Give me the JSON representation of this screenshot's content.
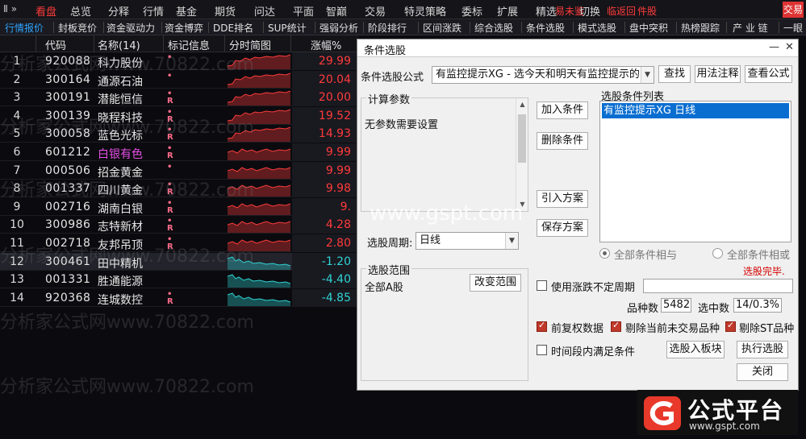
{
  "menu": {
    "logo": "Ⅱ »",
    "items": [
      "看盘",
      "总览",
      "分释",
      "行情",
      "基金",
      "期货",
      "问达",
      "平面",
      "智巅",
      "交易",
      "特灵策略",
      "委标",
      "扩展",
      "精选"
    ],
    "overlay_texts": [
      "易未鉴",
      "切换",
      "临返回",
      "件股"
    ],
    "trade_button": "交易"
  },
  "tabs": [
    "行情报价",
    "封板竞价",
    "资金驱动力",
    "资金博弈",
    "DDE排名",
    "SUP统计",
    "强弱分析",
    "阶段排行",
    "区间涨跌",
    "综合选股",
    "条件选股",
    "模式选股",
    "盘中突积",
    "热榜跟踪",
    "产 业 链",
    "一眼"
  ],
  "table": {
    "headers": [
      "代码",
      "名称(14)",
      "标记信息",
      "分时简图",
      "涨幅%"
    ],
    "rows": [
      {
        "idx": "1",
        "code": "920088",
        "name": "科力股份",
        "mark": "•",
        "pct": "29.99",
        "dir": "up"
      },
      {
        "idx": "2",
        "code": "300164",
        "name": "通源石油",
        "mark": "•",
        "pct": "20.04",
        "dir": "up"
      },
      {
        "idx": "3",
        "code": "300191",
        "name": "潜能恒信",
        "mark": "•R",
        "pct": "20.00",
        "dir": "up"
      },
      {
        "idx": "4",
        "code": "300139",
        "name": "晓程科技",
        "mark": "•R",
        "pct": "19.52",
        "dir": "up"
      },
      {
        "idx": "5",
        "code": "300058",
        "name": "蓝色光标",
        "mark": "•R",
        "pct": "14.93",
        "dir": "up"
      },
      {
        "idx": "6",
        "code": "601212",
        "name": "白银有色",
        "mark": "•R",
        "pct": "9.99",
        "dir": "up",
        "magenta": true
      },
      {
        "idx": "7",
        "code": "000506",
        "name": "招金黄金",
        "mark": "•",
        "pct": "9.99",
        "dir": "up"
      },
      {
        "idx": "8",
        "code": "001337",
        "name": "四川黄金",
        "mark": "•R",
        "pct": "9.98",
        "dir": "up"
      },
      {
        "idx": "9",
        "code": "002716",
        "name": "湖南白银",
        "mark": "•R",
        "pct": "9.",
        "dir": "up"
      },
      {
        "idx": "10",
        "code": "300986",
        "name": "志特新材",
        "mark": "•R",
        "pct": "4.28",
        "dir": "up"
      },
      {
        "idx": "11",
        "code": "002718",
        "name": "友邦吊顶",
        "mark": "•R",
        "pct": "2.80",
        "dir": "up"
      },
      {
        "idx": "12",
        "code": "300461",
        "name": "田中精机",
        "mark": "",
        "pct": "-1.20",
        "dir": "down"
      },
      {
        "idx": "13",
        "code": "001331",
        "name": "胜通能源",
        "mark": "",
        "pct": "-4.40",
        "dir": "down"
      },
      {
        "idx": "14",
        "code": "920368",
        "name": "连城数控",
        "mark": "•R",
        "pct": "-4.85",
        "dir": "down"
      }
    ]
  },
  "watermark": {
    "a": "分析家公式网www.70822.com",
    "b": "分析家公式网www.70822.com"
  },
  "dialog": {
    "title": "条件选股",
    "formula_label": "条件选股公式",
    "formula_value": "有监控提示XG  -  选今天和明天有监控提示的",
    "find_btn": "查找",
    "usage_btn": "用法注释",
    "view_formula_btn": "查看公式",
    "calc_params_legend": "计算参数",
    "no_params_text": "无参数需要设置",
    "add_condition_btn": "加入条件",
    "delete_condition_btn": "删除条件",
    "import_scheme_btn": "引入方案",
    "save_scheme_btn": "保存方案",
    "condition_list_label": "选股条件列表",
    "condition_item": "有监控提示XG  日线",
    "period_label": "选股周期:",
    "period_value": "日线",
    "all_and_label": "全部条件相与",
    "all_or_label": "全部条件相或",
    "done_text": "选股完毕.",
    "range_legend": "选股范围",
    "range_value": "全部A股",
    "change_range_btn": "改变范围",
    "use_unfixed_label": "使用涨跌不定周期",
    "count_label": "品种数",
    "count_value": "5482",
    "selected_label": "选中数",
    "selected_value": "14/0.3%",
    "forward_adj_label": "前复权数据",
    "remove_no_trade_label": "剔除当前未交易品种",
    "remove_st_label": "剔除ST品种",
    "time_range_label": "时间段内满足条件",
    "to_board_btn": "选股入板块",
    "execute_btn": "执行选股",
    "close_btn": "关闭"
  },
  "gspt_watermark": "www.gspt.com",
  "brand": {
    "name": "公式平台",
    "url": "www.gspt.com"
  },
  "colors": {
    "up": "#ff3b3b",
    "down": "#2fd3d3",
    "accent_blue": "#2fa4ff",
    "brand_red": "#e8392b"
  }
}
